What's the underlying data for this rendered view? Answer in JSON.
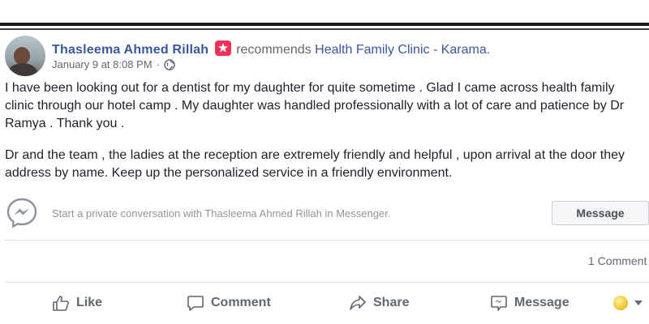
{
  "post": {
    "author": "Thasleema Ahmed Rillah",
    "verb": "recommends",
    "page": "Health Family Clinic - Karama.",
    "timestamp": "January 9 at 8:08 PM",
    "separator": "·",
    "paragraphs": [
      "I have been looking out for a dentist for my daughter for quite sometime . Glad I came across health family clinic through our hotel camp . My daughter was handled professionally with a lot of care and patience by Dr Ramya . Thank you .",
      "Dr and the team , the ladies at the reception are extremely friendly and helpful , upon arrival at the door they address by name. Keep up the personalized service in a friendly environment."
    ]
  },
  "messenger": {
    "prompt": "Start a private conversation with Thasleema Ahmed Rillah in Messenger.",
    "button_label": "Message"
  },
  "stats": {
    "comments": "1 Comment"
  },
  "actions": {
    "like": "Like",
    "comment": "Comment",
    "share": "Share",
    "message": "Message"
  },
  "colors": {
    "link": "#385898",
    "badge": "#f0325a",
    "muted": "#606770"
  }
}
